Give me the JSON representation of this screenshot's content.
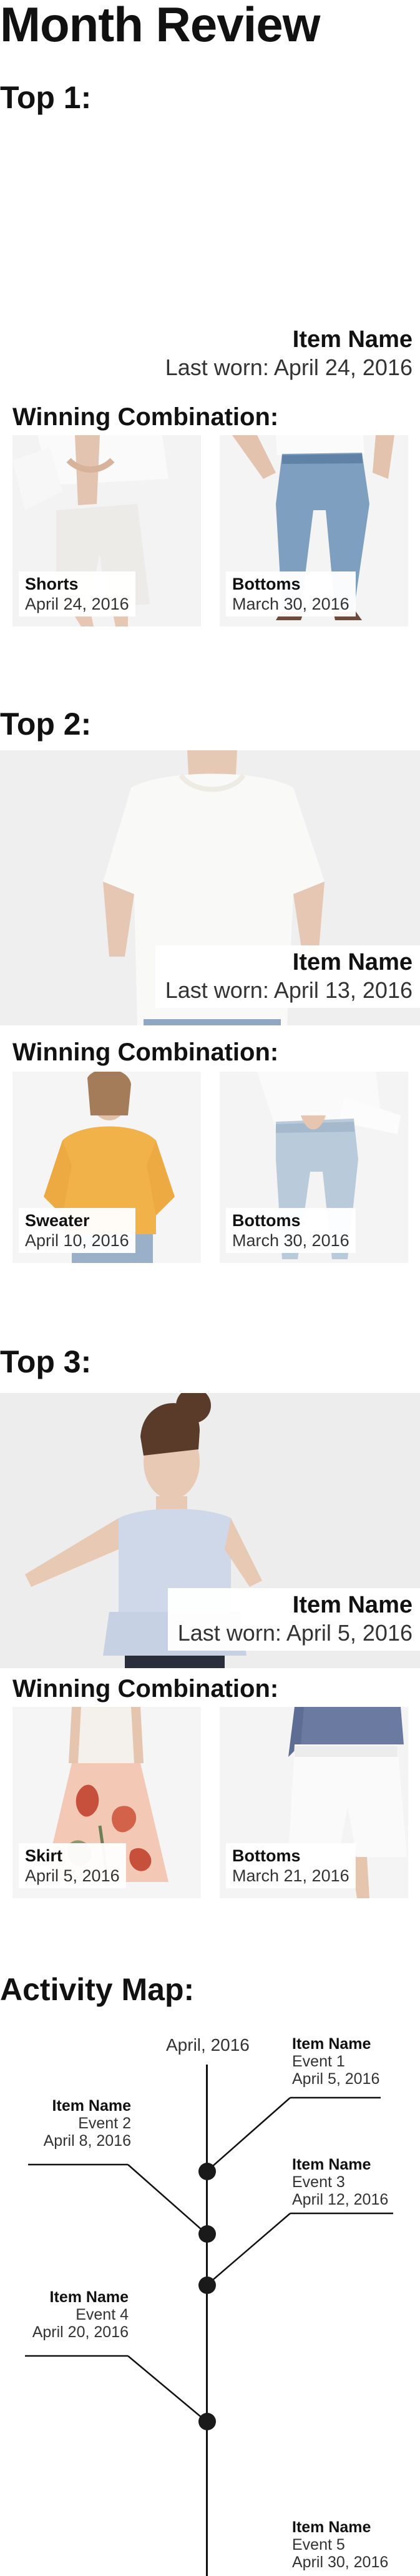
{
  "page": {
    "title": "Month Review"
  },
  "item_name_label": "Item Name",
  "combo_heading": "Winning Combination:",
  "tops": [
    {
      "heading": "Top 1:",
      "item_name": "Item Name",
      "last_worn": "Last worn: April 24, 2016",
      "combination": [
        {
          "category": "Shorts",
          "date": "April 24, 2016"
        },
        {
          "category": "Bottoms",
          "date": "March 30, 2016"
        }
      ]
    },
    {
      "heading": "Top 2:",
      "item_name": "Item Name",
      "last_worn": "Last worn: April 13, 2016",
      "combination": [
        {
          "category": "Sweater",
          "date": "April 10, 2016"
        },
        {
          "category": "Bottoms",
          "date": "March 30, 2016"
        }
      ]
    },
    {
      "heading": "Top 3:",
      "item_name": "Item Name",
      "last_worn": "Last worn: April 5, 2016",
      "combination": [
        {
          "category": "Skirt",
          "date": "April 5, 2016"
        },
        {
          "category": "Bottoms",
          "date": "March 21, 2016"
        }
      ]
    }
  ],
  "activity_map": {
    "heading": "Activity Map:",
    "month_label": "April, 2016",
    "events": [
      {
        "name": "Item Name",
        "title": "Event 1",
        "date": "April 5, 2016",
        "side": "right"
      },
      {
        "name": "Item Name",
        "title": "Event 2",
        "date": "April 8, 2016",
        "side": "left"
      },
      {
        "name": "Item Name",
        "title": "Event 3",
        "date": "April 12, 2016",
        "side": "right"
      },
      {
        "name": "Item Name",
        "title": "Event 4",
        "date": "April 20, 2016",
        "side": "left"
      },
      {
        "name": "Item Name",
        "title": "Event 5",
        "date": "April 30, 2016",
        "side": "right"
      }
    ]
  }
}
